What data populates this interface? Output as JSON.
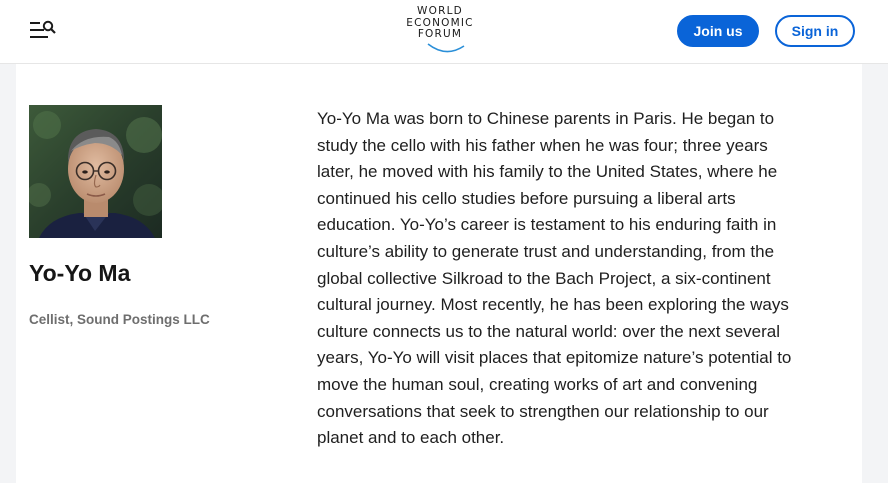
{
  "header": {
    "menu_icon": "menu-search-icon",
    "logo": {
      "lines": [
        "WORLD",
        "ECONOMIC",
        "FORUM"
      ]
    },
    "join_label": "Join us",
    "signin_label": "Sign in"
  },
  "profile": {
    "name": "Yo-Yo Ma",
    "role": "Cellist, Sound Postings LLC",
    "photo_icon": "portrait-photo"
  },
  "bio": {
    "lines": [
      "Yo-Yo Ma was born to Chinese parents in Paris. He began to",
      "study the cello with his father when he was four; three years",
      "later, he moved with his family to the United States, where he",
      "continued his cello studies before pursuing a liberal arts",
      "education. Yo-Yo’s career is testament to his enduring faith in",
      "culture’s ability to generate trust and understanding, from the",
      "global collective Silkroad to the Bach Project, a six-continent",
      "cultural journey. Most recently, he has been exploring the ways",
      "culture connects us to the natural world: over the next several",
      "years, Yo-Yo will visit places that epitomize nature’s potential to",
      "move the human soul, creating works of art and convening",
      "conversations that seek to strengthen our relationship to our",
      "planet and to each other."
    ]
  },
  "colors": {
    "accent": "#0a64d8",
    "gutter": "#f3f4f6"
  }
}
